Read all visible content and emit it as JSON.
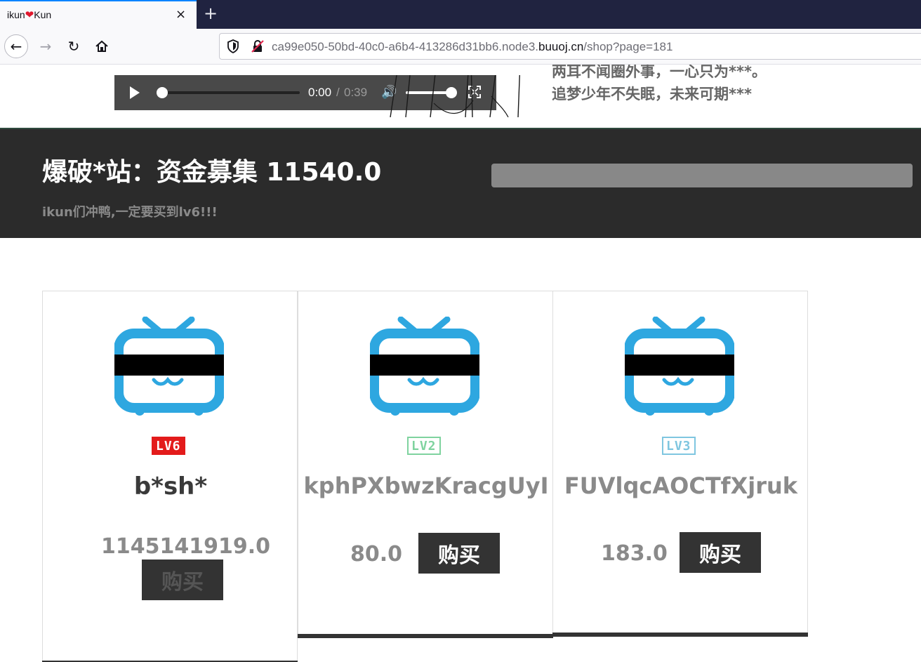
{
  "browser": {
    "tab_title": "ikun",
    "tab_title_suffix": "Kun",
    "tab_close": "×",
    "new_tab": "+",
    "url_prefix": "ca99e050-50bd-40c0-a6b4-413286d31bb6.node3.",
    "url_domain": "buuoj.cn",
    "url_path": "/shop?page=181"
  },
  "player": {
    "current_time": "0:00",
    "separator": "/",
    "total_time": "0:39",
    "progress": 0,
    "volume": 1.0
  },
  "lyrics": {
    "line1": "两耳不闻圈外事，一心只为***。",
    "line2": "追梦少年不失眠，未来可期***"
  },
  "banner": {
    "title": "爆破*站：资金募集 11540.0",
    "subtitle": "ikun们冲鸭,一定要买到lv6!!!"
  },
  "products": [
    {
      "level": "LV6",
      "name": "b*sh*",
      "price": "1145141919.0",
      "buy_label": "购买"
    },
    {
      "level": "LV2",
      "name": "kphPXbwzKracgUyI",
      "price": "80.0",
      "buy_label": "购买"
    },
    {
      "level": "LV3",
      "name": "FUVlqcAOCTfXjruk",
      "price": "183.0",
      "buy_label": "购买"
    }
  ],
  "colors": {
    "tv_blue": "#2ea7e0",
    "banner_bg": "#2b2b2b",
    "badge_red": "#e31b1b",
    "badge_green": "#7fd39f",
    "badge_blue": "#7fc6e0"
  }
}
